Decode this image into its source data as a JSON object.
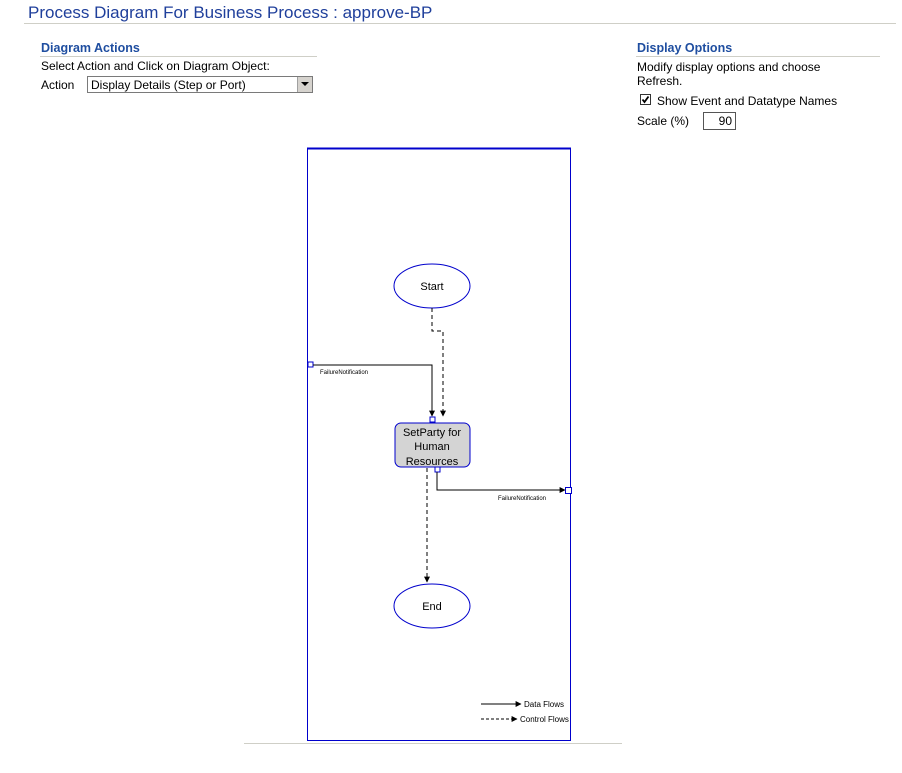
{
  "page": {
    "title": "Process Diagram For Business Process : approve-BP"
  },
  "diagram_actions": {
    "heading": "Diagram Actions",
    "instruction": "Select Action and Click on Diagram Object:",
    "action_label": "Action",
    "action_selected": "Display Details (Step or Port)"
  },
  "display_options": {
    "heading": "Display Options",
    "description_line1": "Modify display options and choose",
    "description_line2": "Refresh.",
    "show_names_label": "Show Event and Datatype Names",
    "show_names_checked": true,
    "scale_label": "Scale (%)",
    "scale_value": "90"
  },
  "diagram": {
    "start_label": "Start",
    "step_label_line1": "SetParty for",
    "step_label_line2": "Human",
    "step_label_line3": "Resources",
    "end_label": "End",
    "left_port_label": "FailureNotification",
    "right_port_label": "FailureNotification",
    "legend_data_flows": "Data Flows",
    "legend_control_flows": "Control Flows"
  },
  "colors": {
    "title": "#1f3f9b",
    "heading": "#1f4ea0",
    "diagram_border": "#0000cc",
    "step_fill": "#d4d4d4"
  }
}
